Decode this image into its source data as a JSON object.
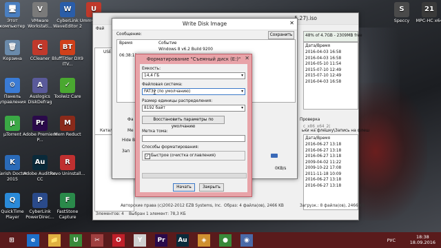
{
  "desktop": {
    "left_icons": [
      {
        "label": "Этот компьютер",
        "color": "#4a7fc1",
        "glyph": "🖥"
      },
      {
        "label": "VMware Workstati...",
        "color": "#7a7a7a",
        "glyph": "V"
      },
      {
        "label": "CyberLink WaveEditor 2",
        "color": "#2a5da8",
        "glyph": "W"
      },
      {
        "label": "Ummy... Ж...",
        "color": "#c0392b",
        "glyph": "U"
      },
      {
        "label": "Корзина",
        "color": "#6a8aaa",
        "glyph": "🗑"
      },
      {
        "label": "CCleaner",
        "color": "#c0392b",
        "glyph": "C"
      },
      {
        "label": "BluffTitler DX9 ITV...",
        "color": "#d0401a",
        "glyph": "BT"
      },
      {
        "label": "Панель управления",
        "color": "#3a7bd5",
        "glyph": "⚙"
      },
      {
        "label": "Auslogics DiskDefrag",
        "color": "#5a5a9a",
        "glyph": "A"
      },
      {
        "label": "Toolwiz Care",
        "color": "#4aa830",
        "glyph": "✓"
      },
      {
        "label": "µTorrent",
        "color": "#3aa845",
        "glyph": "µ"
      },
      {
        "label": "Adobe Premiere P...",
        "color": "#2a0a4a",
        "glyph": "Pr"
      },
      {
        "label": "Mem Reduct",
        "color": "#8a2a1a",
        "glyph": "M"
      },
      {
        "label": "Kerish Doctor 2015",
        "color": "#2a6ab8",
        "glyph": "K"
      },
      {
        "label": "Adobe Audition CC",
        "color": "#0a2a3a",
        "glyph": "Au"
      },
      {
        "label": "Revo Uninstall...",
        "color": "#c03030",
        "glyph": "R"
      },
      {
        "label": "QuickTime Player",
        "color": "#2a8ad8",
        "glyph": "Q"
      },
      {
        "label": "CyberLink PowerDirec...",
        "color": "#2a4a8a",
        "glyph": "P"
      },
      {
        "label": "FastStone Capture",
        "color": "#2a8a4a",
        "glyph": "F"
      }
    ],
    "right_icons": [
      {
        "label": "Speccy",
        "color": "#4a4a4a",
        "glyph": "S"
      },
      {
        "label": "MPC-HC x64",
        "color": "#3a3a3a",
        "glyph": "21"
      }
    ]
  },
  "explorer": {
    "menu_label": "Фай",
    "path_text": "LTSC...",
    "tree_items": [
      "USE",
      "",
      "",
      "",
      ""
    ],
    "statusbar": {
      "items": "Элементов: 4",
      "selected": "Выбран 1 элемент: 78,3 КБ"
    }
  },
  "ultraiso": {
    "title_tail": "...5.27).iso",
    "capacity": "48% of 4.7GB - 2309MB free",
    "list_header": "Дата/Время",
    "dates_top": [
      "2016-04-03 16:58",
      "2016-04-03 16:58",
      "2016-05-10 11:54",
      "2015-07-10 12:49",
      "2015-07-10 12:49",
      "2016-04-03 16:58"
    ],
    "mid_text": "c_x86_x64_2(",
    "path_label": "ьки на флешку\\Запись на флеш",
    "list_header2": "Дата/Время",
    "dates_bottom": [
      "2016-06-27 13:18",
      "2016-06-27 13:18",
      "2016-06-27 13:18",
      "2009-04-02 11:22",
      "2009-10-22 17:08",
      "2011-11-18 10:09",
      "2016-06-27 13:18",
      "2016-06-27 13:18"
    ],
    "status_left": "Авторские права (c)2002-2012 EZB Systems, Inc.",
    "status_mid": "Образ: 4 файла(ов), 2466 KB",
    "status_right": "Загрузк.: 8 файла(ов), 2466 KB"
  },
  "wdi": {
    "title": "Write Disk Image",
    "message_label": "Сообщение:",
    "save_button": "Сохранить",
    "col_time": "Время",
    "col_event": "Событие",
    "row1_event": "Windows 8 v6.2 Build 9200",
    "row2_time": "06:38:11",
    "verify_label": "Проверка",
    "hide_boot_label": "Hide Bo",
    "fa_label": "Фа",
    "speed_value": "0KB/s",
    "left_labels": [
      "Катал",
      "Фа",
      "Ме",
      "Hide Bo",
      "Зап"
    ]
  },
  "format_dialog": {
    "title": "Форматирование \"Съемный диск (E:)\"",
    "capacity_label": "Емкость:",
    "capacity_value": "14,4 ГБ",
    "fs_label": "Файловая система:",
    "fs_value": "FAT32 (по умолчанию)",
    "cluster_label": "Размер единицы распределения:",
    "cluster_value": "8192 байт",
    "restore_button": "Восстановить параметры по умолчанию",
    "volume_label": "Метка тома:",
    "volume_value": "",
    "options_label": "Способы форматирования:",
    "quick_label": "Быстрое (очистка оглавления)",
    "quick_checked": true,
    "start_button": "Начать",
    "close_button": "Закрыть"
  },
  "taskbar": {
    "lang": "РУС",
    "time": "18:38",
    "date": "18.09.2016",
    "apps": [
      {
        "name": "start",
        "glyph": "⊞",
        "color": "#5a1b1c"
      },
      {
        "name": "ie",
        "glyph": "e",
        "color": "#1e6fc9"
      },
      {
        "name": "explorer",
        "glyph": "📁",
        "color": "#e0b040"
      },
      {
        "name": "ultraiso",
        "glyph": "U",
        "color": "#3a8a3a"
      },
      {
        "name": "tools",
        "glyph": "✂",
        "color": "#a04040"
      },
      {
        "name": "opera",
        "glyph": "O",
        "color": "#c0202a"
      },
      {
        "name": "yandex",
        "glyph": "Y",
        "color": "#d0d0d0"
      },
      {
        "name": "premiere",
        "glyph": "Pr",
        "color": "#2a0a4a"
      },
      {
        "name": "audition",
        "glyph": "Au",
        "color": "#0a2a3a"
      },
      {
        "name": "media",
        "glyph": "◈",
        "color": "#d09030"
      },
      {
        "name": "chrome",
        "glyph": "●",
        "color": "#3a8a3a"
      },
      {
        "name": "photo",
        "glyph": "◉",
        "color": "#4a6aa8"
      }
    ]
  }
}
